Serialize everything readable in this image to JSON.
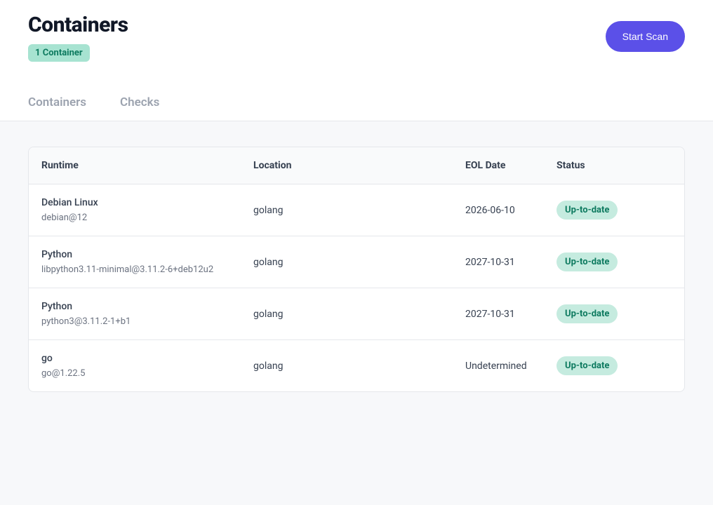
{
  "header": {
    "title": "Containers",
    "count_badge": "1 Container",
    "start_scan": "Start Scan"
  },
  "tabs": [
    {
      "label": "Containers"
    },
    {
      "label": "Checks"
    }
  ],
  "table": {
    "columns": {
      "runtime": "Runtime",
      "location": "Location",
      "eol": "EOL Date",
      "status": "Status"
    },
    "rows": [
      {
        "runtime_name": "Debian Linux",
        "runtime_sub": "debian@12",
        "location": "golang",
        "eol": "2026-06-10",
        "status": "Up-to-date"
      },
      {
        "runtime_name": "Python",
        "runtime_sub": "libpython3.11-minimal@3.11.2-6+deb12u2",
        "location": "golang",
        "eol": "2027-10-31",
        "status": "Up-to-date"
      },
      {
        "runtime_name": "Python",
        "runtime_sub": "python3@3.11.2-1+b1",
        "location": "golang",
        "eol": "2027-10-31",
        "status": "Up-to-date"
      },
      {
        "runtime_name": "go",
        "runtime_sub": "go@1.22.5",
        "location": "golang",
        "eol": "Undetermined",
        "status": "Up-to-date"
      }
    ]
  }
}
